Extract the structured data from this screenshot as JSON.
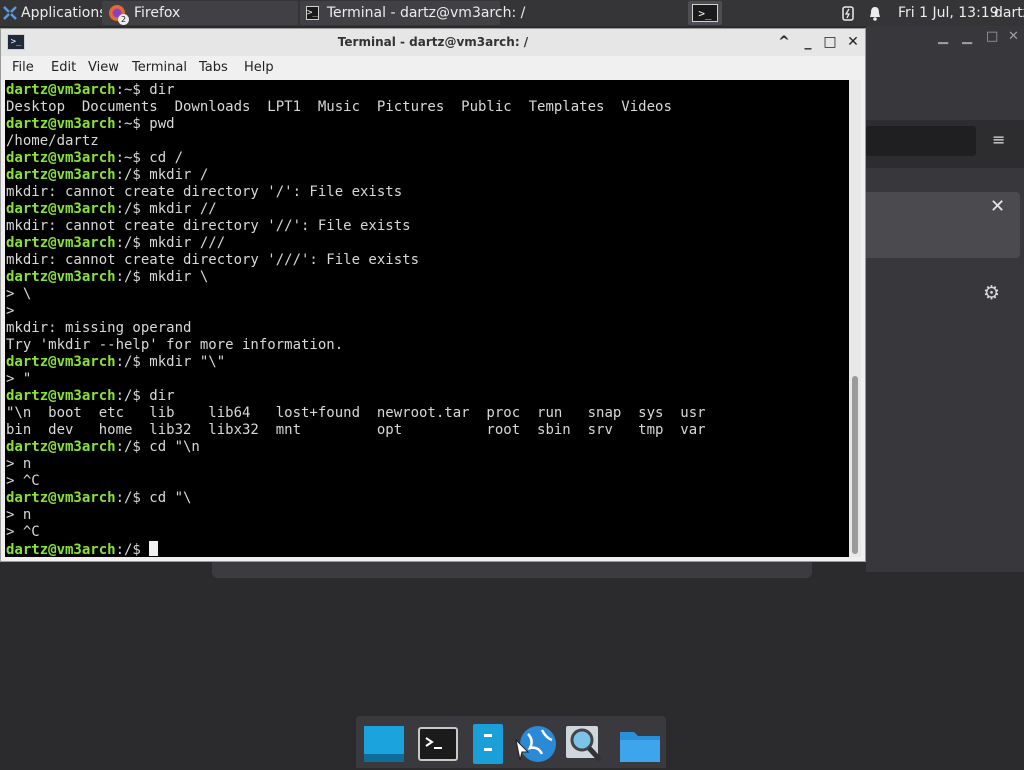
{
  "panel": {
    "applications": "Applications",
    "tasks": [
      {
        "label": "Firefox",
        "badge": "2"
      },
      {
        "label": "Terminal - dartz@vm3arch: /"
      }
    ],
    "clock": "Fri  1 Jul, 13:19",
    "user": "dartz"
  },
  "window": {
    "title": "Terminal - dartz@vm3arch: /",
    "menu": [
      "File",
      "Edit",
      "View",
      "Terminal",
      "Tabs",
      "Help"
    ]
  },
  "terminal": {
    "lines": [
      {
        "p": "dartz@vm3arch",
        "s": ":~$ dir"
      },
      {
        "t": "Desktop  Documents  Downloads  LPT1  Music  Pictures  Public  Templates  Videos"
      },
      {
        "p": "dartz@vm3arch",
        "s": ":~$ pwd"
      },
      {
        "t": "/home/dartz"
      },
      {
        "p": "dartz@vm3arch",
        "s": ":~$ cd /"
      },
      {
        "p": "dartz@vm3arch",
        "s": ":/$ mkdir /"
      },
      {
        "t": "mkdir: cannot create directory '/': File exists"
      },
      {
        "p": "dartz@vm3arch",
        "s": ":/$ mkdir //"
      },
      {
        "t": "mkdir: cannot create directory '//': File exists"
      },
      {
        "p": "dartz@vm3arch",
        "s": ":/$ mkdir ///"
      },
      {
        "t": "mkdir: cannot create directory '///': File exists"
      },
      {
        "p": "dartz@vm3arch",
        "s": ":/$ mkdir \\"
      },
      {
        "t": "> \\"
      },
      {
        "t": ">"
      },
      {
        "t": "mkdir: missing operand"
      },
      {
        "t": "Try 'mkdir --help' for more information."
      },
      {
        "p": "dartz@vm3arch",
        "s": ":/$ mkdir \"\\\""
      },
      {
        "t": "> \""
      },
      {
        "p": "dartz@vm3arch",
        "s": ":/$ dir"
      },
      {
        "t": "\"\\n  boot  etc   lib    lib64   lost+found  newroot.tar  proc  run   snap  sys  usr"
      },
      {
        "t": "bin  dev   home  lib32  libx32  mnt         opt          root  sbin  srv   tmp  var"
      },
      {
        "p": "dartz@vm3arch",
        "s": ":/$ cd \"\\n"
      },
      {
        "t": "> n"
      },
      {
        "t": "> ^C"
      },
      {
        "p": "dartz@vm3arch",
        "s": ":/$ cd \"\\"
      },
      {
        "t": "> n"
      },
      {
        "t": "> ^C"
      },
      {
        "p": "dartz@vm3arch",
        "s": ":/$ ",
        "cursor": true
      }
    ]
  }
}
